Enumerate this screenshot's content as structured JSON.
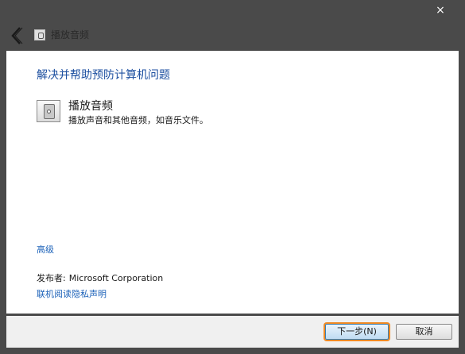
{
  "window": {
    "title": "播放音频",
    "close_glyph": "×",
    "back_label": "后退"
  },
  "content": {
    "heading": "解决并帮助预防计算机问题",
    "item": {
      "title": "播放音频",
      "description": "播放声音和其他音频，如音乐文件。",
      "icon": "speaker-icon"
    },
    "advanced_link": "高级",
    "publisher_label": "发布者:",
    "publisher_value": "Microsoft Corporation",
    "privacy_link": "联机阅读隐私声明"
  },
  "footer": {
    "next_label": "下一步(N)",
    "cancel_label": "取消"
  },
  "colors": {
    "frame": "#4a4a4a",
    "heading": "#1c4fa0",
    "link": "#1c62b9",
    "focus": "#f08a24"
  }
}
